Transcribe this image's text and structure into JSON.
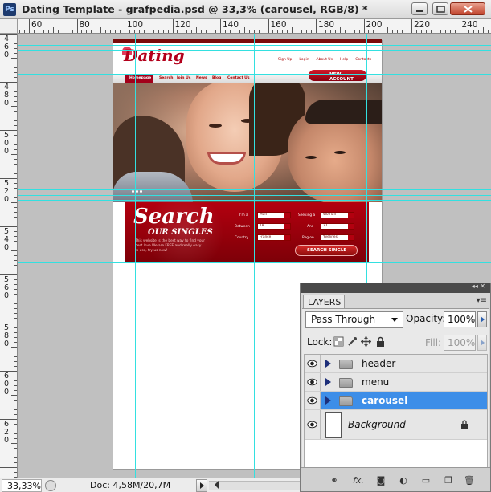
{
  "window": {
    "title": "Dating Template - grafpedia.psd @ 33,3% (carousel, RGB/8) *",
    "app_icon": "Ps"
  },
  "rulers": {
    "horizontal_labels": [
      "60",
      "80",
      "100",
      "120",
      "140",
      "160",
      "180",
      "200",
      "220",
      "240"
    ],
    "vertical_labels": [
      "460",
      "480",
      "500",
      "520",
      "540",
      "560",
      "580",
      "600",
      "620"
    ]
  },
  "website": {
    "logo": "Dating",
    "top_links": [
      "Sign Up",
      "Login",
      "About Us",
      "Help",
      "Contacts"
    ],
    "nav": [
      "Homepage",
      "Search",
      "Join Us",
      "News",
      "Blog",
      "Contact Us"
    ],
    "new_account": "NEW ACCOUNT",
    "search": {
      "title": "Search",
      "subtitle": "OUR SINGLES",
      "text": "This website is the best way to find your best love.We are FREE and really easy to use, try us now!",
      "fields": [
        {
          "label": "I'm a",
          "value": "Man"
        },
        {
          "label": "Seeking a",
          "value": "Woman"
        },
        {
          "label": "Between",
          "value": "18"
        },
        {
          "label": "And",
          "value": "27"
        },
        {
          "label": "Country",
          "value": "France"
        },
        {
          "label": "Region",
          "value": "Yvelines"
        }
      ],
      "button": "SEARCH SINGLE"
    }
  },
  "layers_panel": {
    "tab": "LAYERS",
    "blend_mode": "Pass Through",
    "opacity_label": "Opacity:",
    "opacity_value": "100%",
    "lock_label": "Lock:",
    "fill_label": "Fill:",
    "fill_value": "100%",
    "layers": [
      {
        "name": "header",
        "type": "group",
        "selected": false
      },
      {
        "name": "menu",
        "type": "group",
        "selected": false
      },
      {
        "name": "carousel",
        "type": "group",
        "selected": true
      },
      {
        "name": "Background",
        "type": "background",
        "locked": true
      }
    ],
    "footer_icons": [
      "link-icon",
      "fx-icon",
      "mask-icon",
      "adjustment-icon",
      "folder-icon",
      "new-layer-icon",
      "trash-icon"
    ]
  },
  "status": {
    "zoom": "33,33%",
    "doc": "Doc: 4,58M/20,7M"
  },
  "colors": {
    "guide": "#33e0e0",
    "accent": "#b3000f",
    "selection": "#3d8ee8"
  }
}
